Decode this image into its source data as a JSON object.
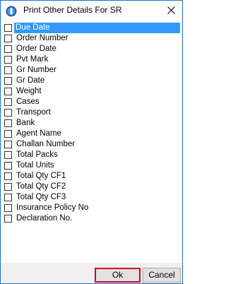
{
  "window": {
    "title": "Print Other Details For SR",
    "icon": "app-icon",
    "close_icon": "close-icon"
  },
  "list": {
    "items": [
      {
        "label": "Due Date",
        "checked": false,
        "selected": true
      },
      {
        "label": "Order Number",
        "checked": false,
        "selected": false
      },
      {
        "label": "Order Date",
        "checked": false,
        "selected": false
      },
      {
        "label": "Pvt Mark",
        "checked": false,
        "selected": false
      },
      {
        "label": "Gr Number",
        "checked": false,
        "selected": false
      },
      {
        "label": "Gr Date",
        "checked": false,
        "selected": false
      },
      {
        "label": "Weight",
        "checked": false,
        "selected": false
      },
      {
        "label": "Cases",
        "checked": false,
        "selected": false
      },
      {
        "label": "Transport",
        "checked": false,
        "selected": false
      },
      {
        "label": "Bank",
        "checked": false,
        "selected": false
      },
      {
        "label": "Agent Name",
        "checked": false,
        "selected": false
      },
      {
        "label": "Challan Number",
        "checked": false,
        "selected": false
      },
      {
        "label": "Total Packs",
        "checked": false,
        "selected": false
      },
      {
        "label": "Total Units",
        "checked": false,
        "selected": false
      },
      {
        "label": "Total Qty CF1",
        "checked": false,
        "selected": false
      },
      {
        "label": "Total Qty CF2",
        "checked": false,
        "selected": false
      },
      {
        "label": "Total Qty CF3",
        "checked": false,
        "selected": false
      },
      {
        "label": "Insurance Policy No",
        "checked": false,
        "selected": false
      },
      {
        "label": "Declaration No.",
        "checked": false,
        "selected": false
      }
    ]
  },
  "buttons": {
    "ok_label": "Ok",
    "cancel_label": "Cancel"
  },
  "colors": {
    "selection": "#3399ff",
    "window_border": "#1a73d6",
    "ok_highlight": "#d0021b",
    "footer_bg": "#f0f0f0"
  }
}
